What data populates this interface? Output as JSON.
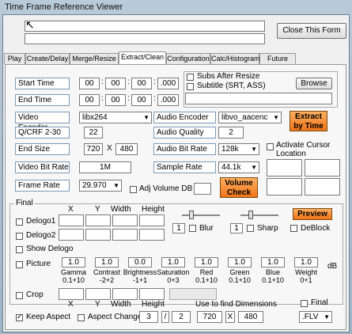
{
  "window": {
    "title": "Time Frame Reference Viewer"
  },
  "close_button": "Close This Form",
  "tabs": [
    "Play",
    "Create/Delay",
    "Merge/Resize",
    "Extract/Clean",
    "Configuration",
    "Calc/Histogram",
    "Future Use"
  ],
  "start_time": {
    "label": "Start Time",
    "h": "00",
    "m": "00",
    "s": "00",
    "ms": ".000"
  },
  "end_time": {
    "label": "End Time",
    "h": "00",
    "m": "00",
    "s": "00",
    "ms": ".000"
  },
  "subs_after_resize": "Subs After Resize",
  "subtitle": "Subtitle (SRT, ASS)",
  "browse": "Browse",
  "video_encoder": {
    "label": "Video Encoder",
    "value": "libx264"
  },
  "audio_encoder": {
    "label": "Audio Encoder",
    "value": "libvo_aacenc"
  },
  "extract_button": "Extract by Time",
  "qcrf": {
    "label": "Q/CRF 2-30",
    "value": "22"
  },
  "audio_quality": {
    "label": "Audio Quality",
    "value": "2"
  },
  "end_size": {
    "label": "End Size",
    "w": "720",
    "x": "X",
    "h": "480"
  },
  "audio_bit_rate": {
    "label": "Audio Bit Rate",
    "value": "128k"
  },
  "activate_cursor": "Activate Cursor Location",
  "video_bit_rate": {
    "label": "Video Bit Rate",
    "value": "1M"
  },
  "sample_rate": {
    "label": "Sample Rate",
    "value": "44.1k"
  },
  "frame_rate": {
    "label": "Frame Rate",
    "value": "29.970"
  },
  "adj_volume": "Adj Volume DB",
  "volume_check": "Volume Check",
  "final_group": "Final",
  "cols": {
    "x": "X",
    "y": "Y",
    "width": "Width",
    "height": "Height"
  },
  "delogo1": "Delogo1",
  "delogo2": "Delogo2",
  "show_delogo": "Show Delogo",
  "blur": {
    "value": "1",
    "label": "Blur"
  },
  "sharp": {
    "value": "1",
    "label": "Sharp"
  },
  "preview": "Preview",
  "deblock": "DeBlock",
  "picture": "Picture",
  "db": "dB",
  "picture_params": [
    {
      "value": "1.0",
      "name": "Gamma",
      "range": "0.1+10"
    },
    {
      "value": "1.0",
      "name": "Contrast",
      "range": "-2+2"
    },
    {
      "value": "0.0",
      "name": "Brightness",
      "range": "-1+1"
    },
    {
      "value": "1.0",
      "name": "Saturation",
      "range": "0+3"
    },
    {
      "value": "1.0",
      "name": "Red",
      "range": "0.1+10"
    },
    {
      "value": "1.0",
      "name": "Green",
      "range": "0.1+10"
    },
    {
      "value": "1.0",
      "name": "Blue",
      "range": "0.1+10"
    },
    {
      "value": "1.0",
      "name": "Weight",
      "range": "0+1"
    }
  ],
  "crop": "Crop",
  "use_to_find": "Use to find Dimensions",
  "final_check": "Final",
  "keep_aspect": "Keep Aspect",
  "aspect_change": {
    "label": "Aspect Change",
    "a": "3",
    "sep": "/",
    "b": "2"
  },
  "dims": {
    "w": "720",
    "x": "X",
    "h": "480"
  },
  "format": ".FLV"
}
